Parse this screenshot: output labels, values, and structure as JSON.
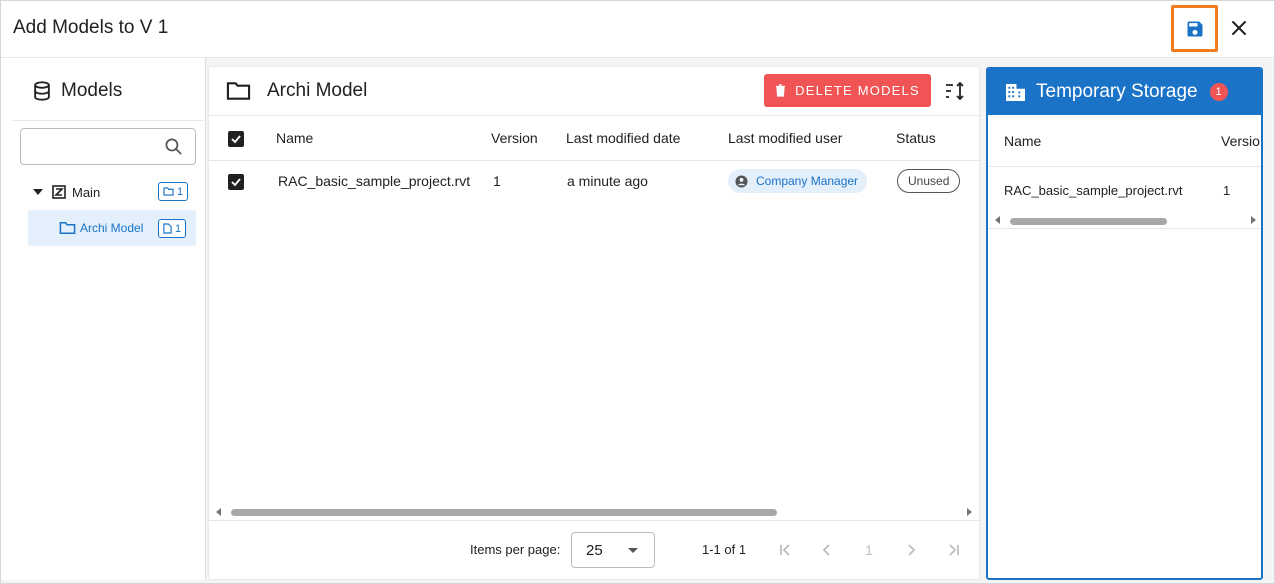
{
  "dialog": {
    "title": "Add Models to V 1",
    "accent": "#1a73c7",
    "save_icon": "floppy-disk-icon",
    "close_icon": "close-icon"
  },
  "sidebar": {
    "title": "Models",
    "title_icon": "database-icon",
    "search": {
      "value": "",
      "placeholder": ""
    },
    "tree": [
      {
        "label": "Main",
        "icon": "z-box-icon",
        "badge_icon": "folder-icon",
        "badge_count": "1",
        "expanded": true
      },
      {
        "label": "Archi Model",
        "icon": "folder-icon",
        "badge_icon": "file-icon",
        "badge_count": "1",
        "selected": true
      }
    ]
  },
  "main": {
    "title": "Archi Model",
    "title_icon": "folder-icon",
    "delete_label": "DELETE MODELS",
    "delete_color": "#f05454",
    "columns": [
      "Name",
      "Version",
      "Last modified date",
      "Last modified user",
      "Status"
    ],
    "rows": [
      {
        "checked": true,
        "name": "RAC_basic_sample_project.rvt",
        "version": "1",
        "modified_date": "a minute ago",
        "modified_user": "Company Manager",
        "status": "Unused"
      }
    ],
    "pagination": {
      "items_per_page_label": "Items per page:",
      "items_per_page": "25",
      "range": "1-1 of 1",
      "page": "1"
    }
  },
  "storage": {
    "title": "Temporary Storage",
    "title_icon": "building-icon",
    "badge": "1",
    "columns": [
      "Name",
      "Versio"
    ],
    "rows": [
      {
        "name": "RAC_basic_sample_project.rvt",
        "version": "1"
      }
    ]
  }
}
